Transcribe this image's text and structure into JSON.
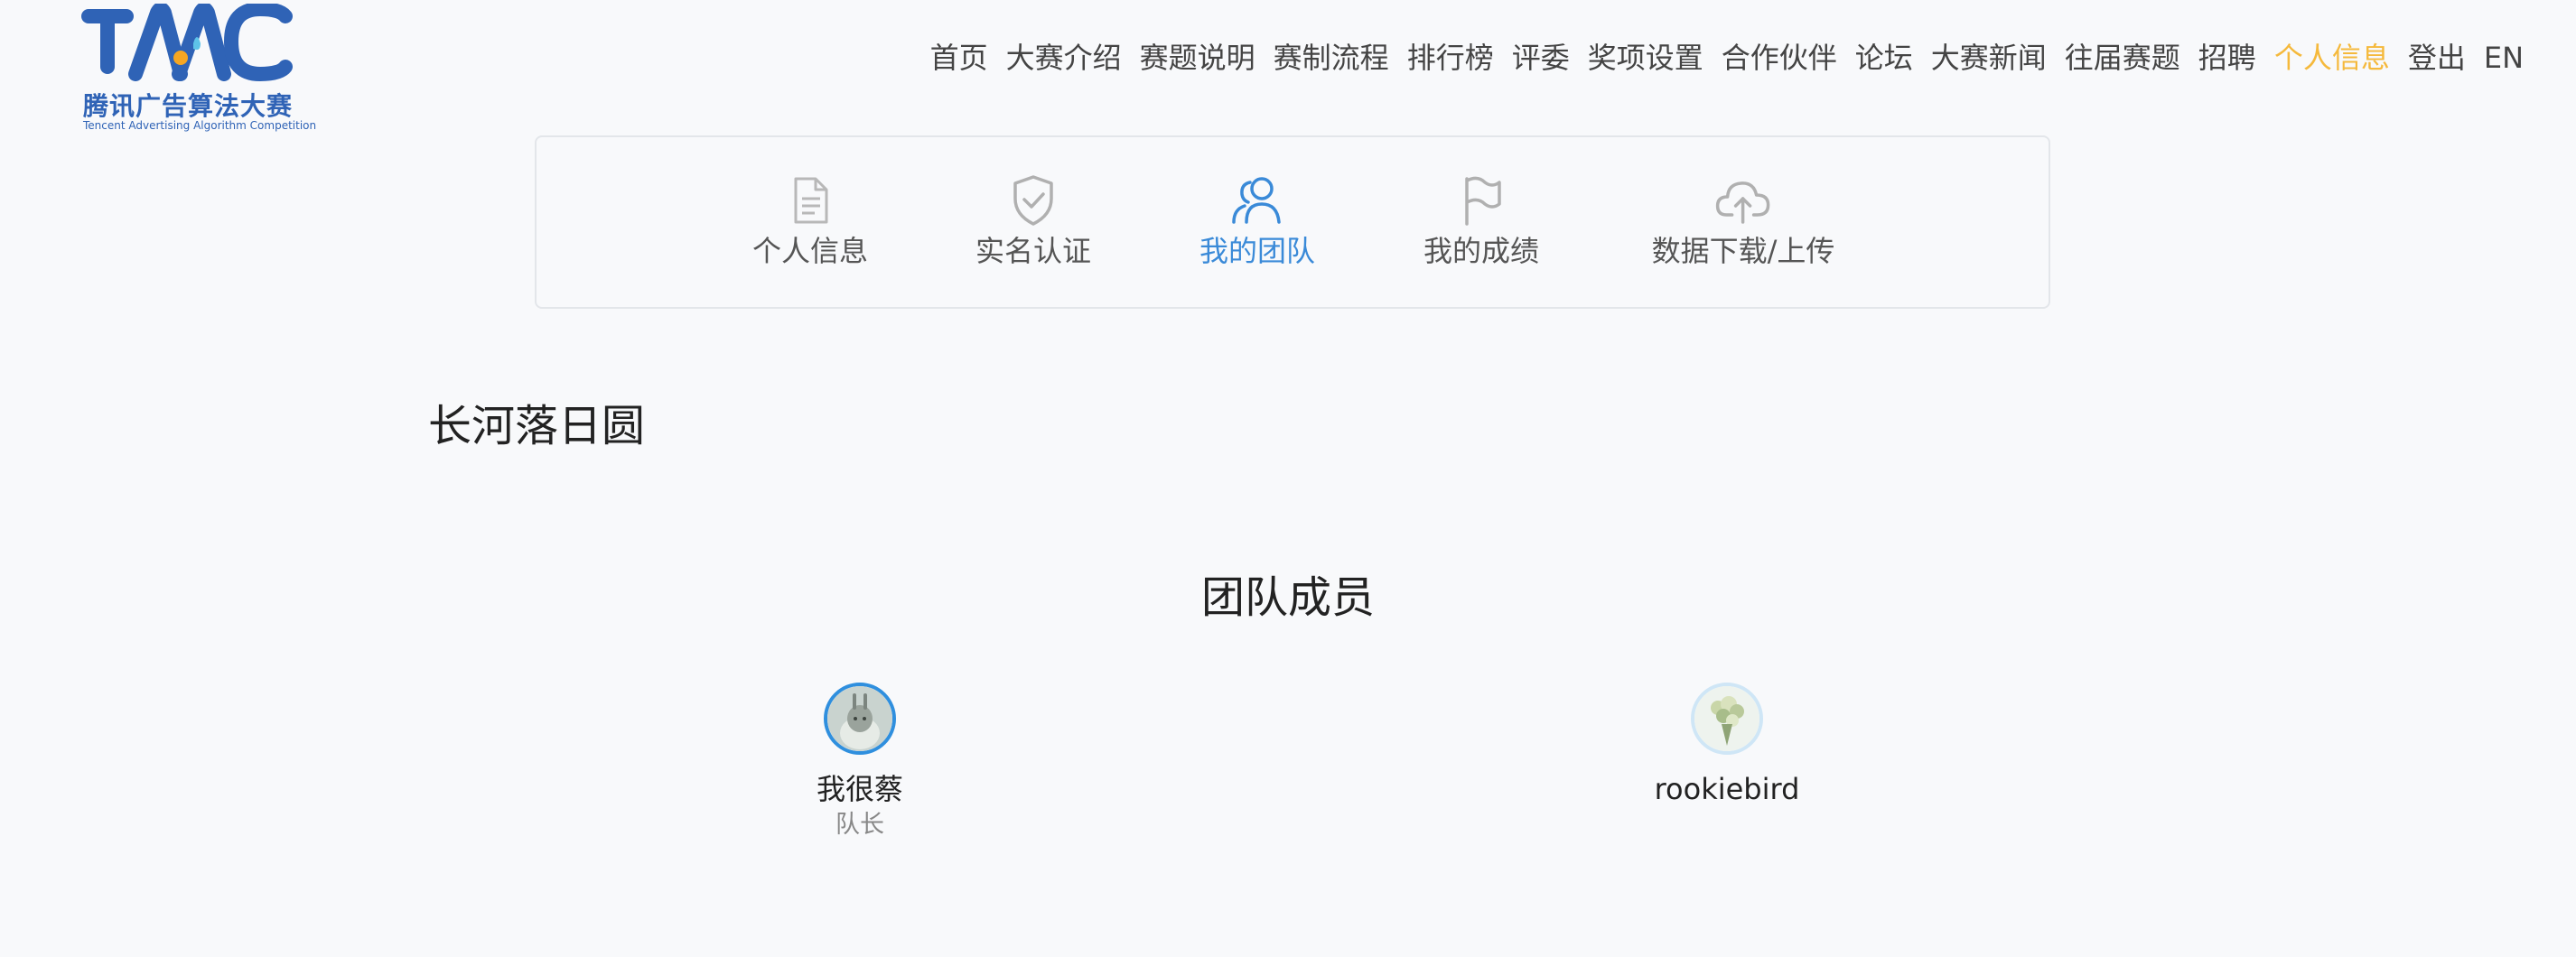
{
  "logo": {
    "mark": "TAAC",
    "title_cn": "腾讯广告算法大赛",
    "title_en": "Tencent Advertising Algorithm Competition"
  },
  "nav": {
    "items": [
      {
        "label": "首页"
      },
      {
        "label": "大赛介绍"
      },
      {
        "label": "赛题说明"
      },
      {
        "label": "赛制流程"
      },
      {
        "label": "排行榜"
      },
      {
        "label": "评委"
      },
      {
        "label": "奖项设置"
      },
      {
        "label": "合作伙伴"
      },
      {
        "label": "论坛"
      },
      {
        "label": "大赛新闻"
      },
      {
        "label": "往届赛题"
      },
      {
        "label": "招聘"
      },
      {
        "label": "个人信息",
        "active": true
      },
      {
        "label": "登出"
      },
      {
        "label": "EN"
      }
    ]
  },
  "tabs": [
    {
      "label": "个人信息",
      "icon": "document-icon"
    },
    {
      "label": "实名认证",
      "icon": "shield-check-icon"
    },
    {
      "label": "我的团队",
      "icon": "team-icon",
      "active": true
    },
    {
      "label": "我的成绩",
      "icon": "flag-icon"
    },
    {
      "label": "数据下载/上传",
      "icon": "cloud-upload-icon"
    }
  ],
  "team": {
    "name": "长河落日圆",
    "members_title": "团队成员",
    "members": [
      {
        "name": "我很蔡",
        "role": "队长",
        "avatar": "avatar-rabbit"
      },
      {
        "name": "rookiebird",
        "role": "",
        "avatar": "avatar-flowers"
      }
    ]
  },
  "colors": {
    "accent_active_nav": "#f5b93c",
    "accent_active_tab": "#3a8ad8",
    "brand": "#2f63b6"
  }
}
